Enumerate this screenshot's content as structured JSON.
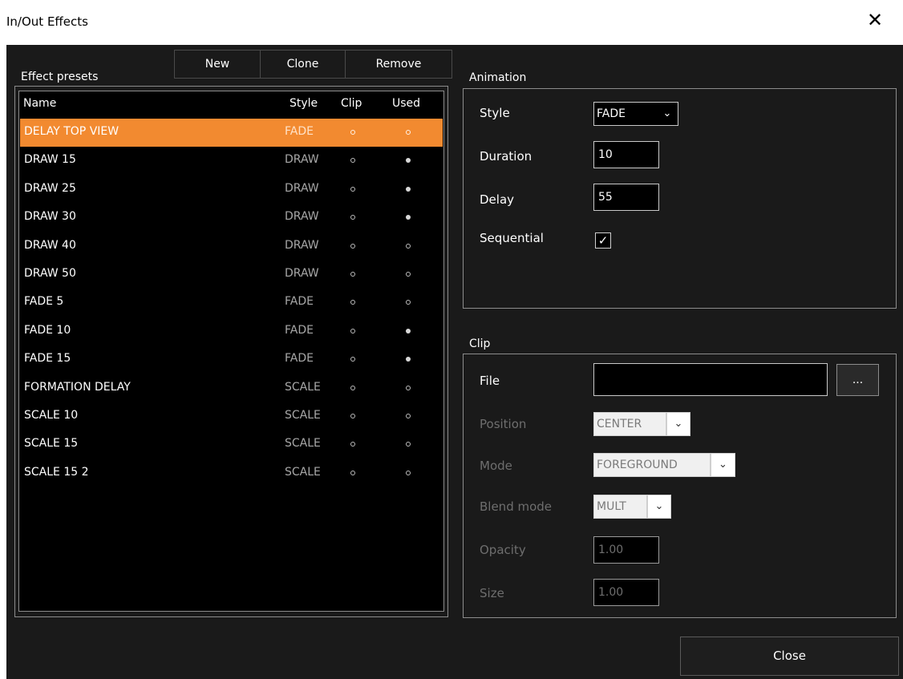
{
  "window": {
    "title": "In/Out Effects",
    "close_glyph": "✕"
  },
  "toolbar": {
    "new_label": "New",
    "clone_label": "Clone",
    "remove_label": "Remove"
  },
  "presets": {
    "group_label": "Effect presets",
    "columns": {
      "name": "Name",
      "style": "Style",
      "clip": "Clip",
      "used": "Used"
    },
    "selected_index": 0,
    "rows": [
      {
        "name": "DELAY TOP VIEW",
        "style": "FADE",
        "clip": false,
        "used": false
      },
      {
        "name": "DRAW 15",
        "style": "DRAW",
        "clip": false,
        "used": true
      },
      {
        "name": "DRAW 25",
        "style": "DRAW",
        "clip": false,
        "used": true
      },
      {
        "name": "DRAW 30",
        "style": "DRAW",
        "clip": false,
        "used": true
      },
      {
        "name": "DRAW 40",
        "style": "DRAW",
        "clip": false,
        "used": false
      },
      {
        "name": "DRAW 50",
        "style": "DRAW",
        "clip": false,
        "used": false
      },
      {
        "name": "FADE 5",
        "style": "FADE",
        "clip": false,
        "used": false
      },
      {
        "name": "FADE 10",
        "style": "FADE",
        "clip": false,
        "used": true
      },
      {
        "name": "FADE 15",
        "style": "FADE",
        "clip": false,
        "used": true
      },
      {
        "name": "FORMATION DELAY",
        "style": "SCALE",
        "clip": false,
        "used": false
      },
      {
        "name": "SCALE 10",
        "style": "SCALE",
        "clip": false,
        "used": false
      },
      {
        "name": "SCALE 15",
        "style": "SCALE",
        "clip": false,
        "used": false
      },
      {
        "name": "SCALE 15 2",
        "style": "SCALE",
        "clip": false,
        "used": false
      }
    ]
  },
  "animation": {
    "group_label": "Animation",
    "style_label": "Style",
    "style_value": "FADE",
    "duration_label": "Duration",
    "duration_value": "10",
    "delay_label": "Delay",
    "delay_value": "55",
    "sequential_label": "Sequential",
    "sequential_checked": true
  },
  "clip": {
    "group_label": "Clip",
    "file_label": "File",
    "file_value": "",
    "browse_label": "...",
    "position_label": "Position",
    "position_value": "CENTER",
    "mode_label": "Mode",
    "mode_value": "FOREGROUND",
    "blend_label": "Blend mode",
    "blend_value": "MULT",
    "opacity_label": "Opacity",
    "opacity_value": "1.00",
    "size_label": "Size",
    "size_value": "1.00"
  },
  "footer": {
    "close_label": "Close"
  },
  "colors": {
    "background": "#1a1a1a",
    "selection": "#f28a30",
    "list_background": "#000000"
  }
}
